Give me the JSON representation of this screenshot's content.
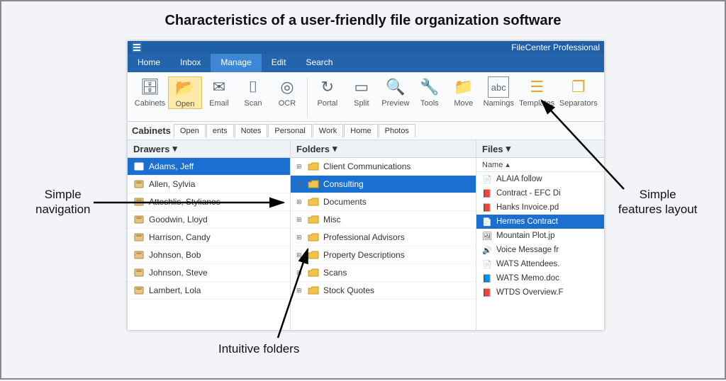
{
  "page_title": "Characteristics of a user-friendly file organization software",
  "callouts": {
    "nav": "Simple\nnavigation",
    "folders": "Intuitive folders",
    "features": "Simple\nfeatures layout"
  },
  "app": {
    "brand": "FileCenter Professional",
    "tabs": {
      "home": "Home",
      "inbox": "Inbox",
      "manage": "Manage",
      "edit": "Edit",
      "search": "Search"
    },
    "ribbon": {
      "cabinets": "Cabinets",
      "open": "Open",
      "email": "Email",
      "scan": "Scan",
      "ocr": "OCR",
      "portal": "Portal",
      "split": "Split",
      "preview": "Preview",
      "tools": "Tools",
      "move": "Move",
      "namings": "Namings",
      "templates": "Templates",
      "separators": "Separators"
    },
    "cabtabs": {
      "title": "Cabinets",
      "open": "Open",
      "ents": "ents",
      "notes": "Notes",
      "personal": "Personal",
      "work": "Work",
      "home": "Home",
      "photos": "Photos"
    },
    "drawers": {
      "header": "Drawers",
      "items": [
        "Adams, Jeff",
        "Allen, Sylvia",
        "Atteshlis, Stylianos",
        "Goodwin, Lloyd",
        "Harrison, Candy",
        "Johnson, Bob",
        "Johnson, Steve",
        "Lambert, Lola"
      ],
      "selected": 0
    },
    "folders": {
      "header": "Folders",
      "items": [
        "Client Communications",
        "Consulting",
        "Documents",
        "Misc",
        "Professional Advisors",
        "Property Descriptions",
        "Scans",
        "Stock Quotes"
      ],
      "selected": 1
    },
    "files": {
      "header": "Files",
      "name_col": "Name",
      "items": [
        {
          "name": "ALAIA follow",
          "type": "doc"
        },
        {
          "name": "Contract - EFC Di",
          "type": "pdf"
        },
        {
          "name": "Hanks Invoice.pd",
          "type": "pdf"
        },
        {
          "name": "Hermes Contract",
          "type": "doc"
        },
        {
          "name": "Mountain Plot.jp",
          "type": "img"
        },
        {
          "name": "Voice Message fr",
          "type": "audio"
        },
        {
          "name": "WATS Attendees.",
          "type": "doc"
        },
        {
          "name": "WATS Memo.doc",
          "type": "word"
        },
        {
          "name": "WTDS Overview.F",
          "type": "pdf"
        }
      ],
      "selected": 3
    }
  }
}
